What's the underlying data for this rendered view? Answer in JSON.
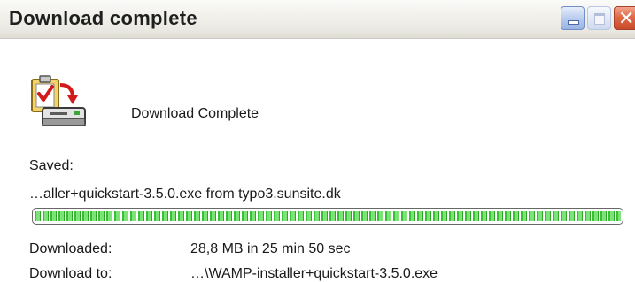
{
  "window": {
    "title": "Download complete"
  },
  "dialog": {
    "icon": "download-complete-icon",
    "complete_label": "Download Complete",
    "saved_label": "Saved:",
    "saved_file": "…aller+quickstart-3.5.0.exe from typo3.sunsite.dk",
    "progress_percent": 100,
    "details": [
      {
        "label": "Downloaded:",
        "value": "28,8 MB in 25 min 50 sec"
      },
      {
        "label": "Download to:",
        "value": "…\\WAMP-installer+quickstart-3.5.0.exe"
      }
    ]
  },
  "colors": {
    "titlebar": "#ECE9D8",
    "progress_green": "#37C12E",
    "close_button": "#E06A46",
    "minimize_button": "#B6C9EE"
  }
}
